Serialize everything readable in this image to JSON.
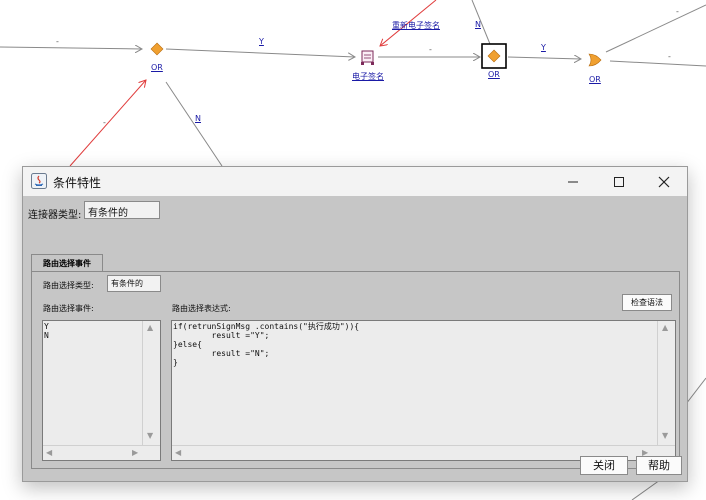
{
  "workflow": {
    "node_labels": {
      "or1": "OR",
      "sign": "电子签名",
      "or2": "OR",
      "or3": "OR",
      "resign": "重新电子签名"
    },
    "edge_labels": {
      "e1": "-",
      "e2": "Y",
      "e3": "-",
      "e4": "Y",
      "e5": "-",
      "e6": "N",
      "e7": "-",
      "e8": "N",
      "e9": "-"
    }
  },
  "dialog": {
    "title": "条件特性",
    "window_buttons": {
      "minimize": "minimize-icon",
      "maximize": "maximize-icon",
      "close": "close-icon"
    },
    "connector_type_label": "连接器类型:",
    "connector_type_value": "有条件的",
    "tab_label": "路由选择事件",
    "route_type_label": "路由选择类型:",
    "route_type_value": "有条件的",
    "events_label": "路由选择事件:",
    "events_text": "Y\nN",
    "expression_label": "路由选择表达式:",
    "expression_text": "if(retrunSignMsg .contains(\"执行成功\")){\n        result =\"Y\";\n}else{\n        result =\"N\";\n}",
    "check_syntax_button": "检查语法",
    "close_button": "关闭",
    "help_button": "帮助"
  },
  "colors": {
    "diamond": "#f0a030",
    "selection_box": "#000000",
    "link_blue": "#1a1aa6",
    "red_edge": "#e03c3c",
    "dialog_bg": "#c6c6c6"
  }
}
